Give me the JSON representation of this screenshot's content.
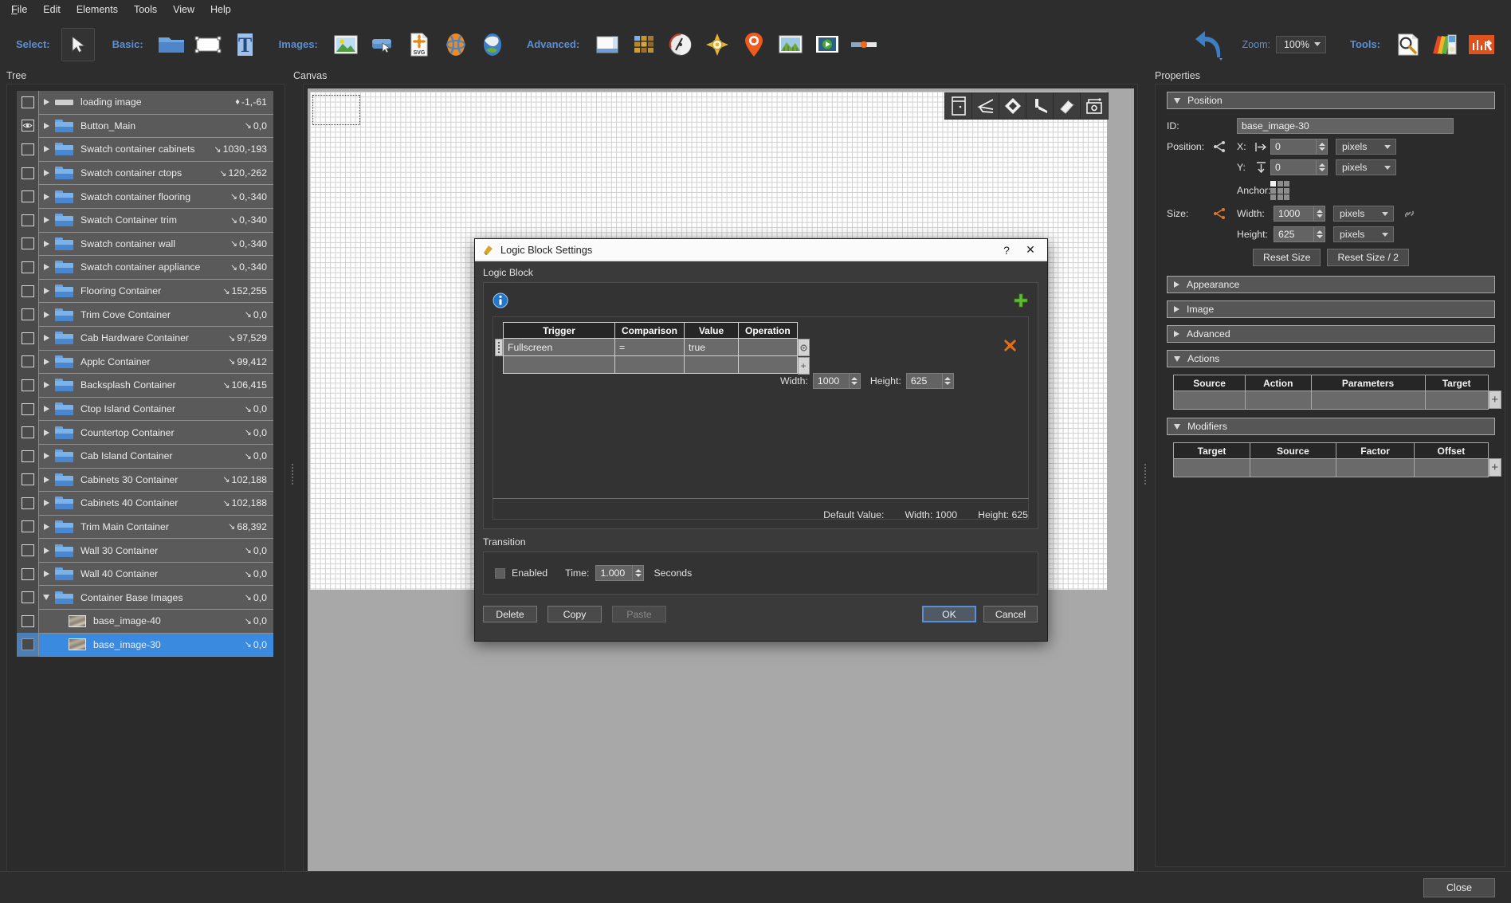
{
  "menubar": [
    {
      "label": "File",
      "accel": "F"
    },
    {
      "label": "Edit",
      "accel": "E"
    },
    {
      "label": "Elements",
      "accel": "l"
    },
    {
      "label": "Tools",
      "accel": "T"
    },
    {
      "label": "View",
      "accel": "V"
    },
    {
      "label": "Help",
      "accel": "H"
    }
  ],
  "toolbar": {
    "select_label": "Select:",
    "basic_label": "Basic:",
    "images_label": "Images:",
    "advanced_label": "Advanced:",
    "zoom_label": "Zoom:",
    "zoom_value": "100%",
    "tools_label": "Tools:",
    "select_tools": [
      {
        "name": "arrow-cursor-icon"
      }
    ],
    "basic_tools": [
      {
        "name": "folder-icon"
      },
      {
        "name": "rectangle-icon"
      },
      {
        "name": "text-icon"
      }
    ],
    "image_tools": [
      {
        "name": "picture-icon"
      },
      {
        "name": "button-image-icon"
      },
      {
        "name": "svg-file-icon"
      },
      {
        "name": "globe-image-icon"
      },
      {
        "name": "map-image-icon"
      }
    ],
    "advanced_tools": [
      {
        "name": "window-layout-icon"
      },
      {
        "name": "grid-tiles-icon"
      },
      {
        "name": "gauge-icon"
      },
      {
        "name": "compass-icon"
      },
      {
        "name": "map-pin-icon"
      },
      {
        "name": "panorama-icon"
      },
      {
        "name": "video-icon"
      },
      {
        "name": "slider-icon"
      }
    ],
    "undo": {
      "name": "undo-arrow-icon"
    },
    "right_tools": [
      {
        "name": "magnifier-page-icon"
      },
      {
        "name": "color-swatch-icon"
      },
      {
        "name": "toolbox-icon"
      }
    ]
  },
  "tree": {
    "title": "Tree",
    "items": [
      {
        "label": "loading image",
        "pos": "-1,-61",
        "glyph": "dot",
        "icon": "bar-image-icon",
        "visible": false,
        "expandable": true,
        "expanded": false,
        "child": false,
        "selected": false
      },
      {
        "label": "Button_Main",
        "pos": "0,0",
        "glyph": "arrow",
        "icon": "folder-icon",
        "visible": true,
        "expandable": true,
        "expanded": false,
        "child": false,
        "selected": false
      },
      {
        "label": "Swatch container cabinets",
        "pos": "1030,-193",
        "glyph": "arrow",
        "icon": "folder-icon",
        "visible": false,
        "expandable": true,
        "expanded": false,
        "child": false,
        "selected": false
      },
      {
        "label": "Swatch container ctops",
        "pos": "120,-262",
        "glyph": "arrow",
        "icon": "folder-icon",
        "visible": false,
        "expandable": true,
        "expanded": false,
        "child": false,
        "selected": false
      },
      {
        "label": "Swatch container flooring",
        "pos": "0,-340",
        "glyph": "arrow",
        "icon": "folder-icon",
        "visible": false,
        "expandable": true,
        "expanded": false,
        "child": false,
        "selected": false
      },
      {
        "label": "Swatch Container trim",
        "pos": "0,-340",
        "glyph": "arrow",
        "icon": "folder-icon",
        "visible": false,
        "expandable": true,
        "expanded": false,
        "child": false,
        "selected": false
      },
      {
        "label": "Swatch container wall",
        "pos": "0,-340",
        "glyph": "arrow",
        "icon": "folder-icon",
        "visible": false,
        "expandable": true,
        "expanded": false,
        "child": false,
        "selected": false
      },
      {
        "label": "Swatch container appliance",
        "pos": "0,-340",
        "glyph": "arrow",
        "icon": "folder-icon",
        "visible": false,
        "expandable": true,
        "expanded": false,
        "child": false,
        "selected": false
      },
      {
        "label": "Flooring Container",
        "pos": "152,255",
        "glyph": "arrow",
        "icon": "folder-icon",
        "visible": false,
        "expandable": true,
        "expanded": false,
        "child": false,
        "selected": false
      },
      {
        "label": "Trim Cove Container",
        "pos": "0,0",
        "glyph": "arrow",
        "icon": "folder-icon",
        "visible": false,
        "expandable": true,
        "expanded": false,
        "child": false,
        "selected": false
      },
      {
        "label": "Cab Hardware Container",
        "pos": "97,529",
        "glyph": "arrow",
        "icon": "folder-icon",
        "visible": false,
        "expandable": true,
        "expanded": false,
        "child": false,
        "selected": false
      },
      {
        "label": "Applc Container",
        "pos": "99,412",
        "glyph": "arrow",
        "icon": "folder-icon",
        "visible": false,
        "expandable": true,
        "expanded": false,
        "child": false,
        "selected": false
      },
      {
        "label": "Backsplash Container",
        "pos": "106,415",
        "glyph": "arrow",
        "icon": "folder-icon",
        "visible": false,
        "expandable": true,
        "expanded": false,
        "child": false,
        "selected": false
      },
      {
        "label": "Ctop Island Container",
        "pos": "0,0",
        "glyph": "arrow",
        "icon": "folder-icon",
        "visible": false,
        "expandable": true,
        "expanded": false,
        "child": false,
        "selected": false
      },
      {
        "label": "Countertop Container",
        "pos": "0,0",
        "glyph": "arrow",
        "icon": "folder-icon",
        "visible": false,
        "expandable": true,
        "expanded": false,
        "child": false,
        "selected": false
      },
      {
        "label": "Cab Island Container",
        "pos": "0,0",
        "glyph": "arrow",
        "icon": "folder-icon",
        "visible": false,
        "expandable": true,
        "expanded": false,
        "child": false,
        "selected": false
      },
      {
        "label": "Cabinets 30 Container",
        "pos": "102,188",
        "glyph": "arrow",
        "icon": "folder-icon",
        "visible": false,
        "expandable": true,
        "expanded": false,
        "child": false,
        "selected": false
      },
      {
        "label": "Cabinets 40 Container",
        "pos": "102,188",
        "glyph": "arrow",
        "icon": "folder-icon",
        "visible": false,
        "expandable": true,
        "expanded": false,
        "child": false,
        "selected": false
      },
      {
        "label": "Trim Main Container",
        "pos": "68,392",
        "glyph": "arrow",
        "icon": "folder-icon",
        "visible": false,
        "expandable": true,
        "expanded": false,
        "child": false,
        "selected": false
      },
      {
        "label": "Wall 30 Container",
        "pos": "0,0",
        "glyph": "arrow",
        "icon": "folder-icon",
        "visible": false,
        "expandable": true,
        "expanded": false,
        "child": false,
        "selected": false
      },
      {
        "label": "Wall 40 Container",
        "pos": "0,0",
        "glyph": "arrow",
        "icon": "folder-icon",
        "visible": false,
        "expandable": true,
        "expanded": false,
        "child": false,
        "selected": false
      },
      {
        "label": "Container Base Images",
        "pos": "0,0",
        "glyph": "arrow",
        "icon": "folder-icon",
        "visible": false,
        "expandable": true,
        "expanded": true,
        "child": false,
        "selected": false
      },
      {
        "label": "base_image-40",
        "pos": "0,0",
        "glyph": "arrow",
        "icon": "thumbnail-icon",
        "visible": false,
        "expandable": false,
        "expanded": false,
        "child": true,
        "selected": false
      },
      {
        "label": "base_image-30",
        "pos": "0,0",
        "glyph": "arrow",
        "icon": "thumbnail-icon",
        "visible": false,
        "expandable": false,
        "expanded": false,
        "child": true,
        "selected": true
      }
    ]
  },
  "canvas": {
    "title": "Canvas",
    "tools": [
      {
        "name": "cabinet-icon"
      },
      {
        "name": "ceiling-icon"
      },
      {
        "name": "floor-tile-icon"
      },
      {
        "name": "counter-icon"
      },
      {
        "name": "paint-roller-icon"
      },
      {
        "name": "appliance-icon"
      }
    ]
  },
  "properties": {
    "title": "Properties",
    "position_section": {
      "label": "Position",
      "expanded": true,
      "id_label": "ID:",
      "id_value": "base_image-30",
      "position_label": "Position:",
      "x_label": "X:",
      "x_value": "0",
      "x_units": "pixels",
      "y_label": "Y:",
      "y_value": "0",
      "y_units": "pixels",
      "anchor_label": "Anchor:",
      "size_label": "Size:",
      "width_label": "Width:",
      "width_value": "1000",
      "width_units": "pixels",
      "height_label": "Height:",
      "height_value": "625",
      "height_units": "pixels",
      "reset_size": "Reset Size",
      "reset_size_half": "Reset Size / 2"
    },
    "sections": [
      {
        "label": "Appearance",
        "expanded": false
      },
      {
        "label": "Image",
        "expanded": false
      },
      {
        "label": "Advanced",
        "expanded": false
      }
    ],
    "actions": {
      "label": "Actions",
      "expanded": true,
      "columns": [
        "Source",
        "Action",
        "Parameters",
        "Target"
      ],
      "rows": [
        [
          "",
          "",
          "",
          ""
        ]
      ]
    },
    "modifiers": {
      "label": "Modifiers",
      "expanded": true,
      "columns": [
        "Target",
        "Source",
        "Factor",
        "Offset"
      ],
      "rows": [
        [
          "",
          "",
          "",
          ""
        ]
      ]
    }
  },
  "dialog": {
    "title": "Logic Block Settings",
    "icon": "app-logo-icon",
    "help_label": "?",
    "close_label": "✕",
    "section_label": "Logic Block",
    "info_icon": "info-icon",
    "add_icon": "add-plus-icon",
    "delete_row_icon": "delete-x-icon",
    "table": {
      "columns": [
        "Trigger",
        "Comparison",
        "Value",
        "Operation"
      ],
      "rows": [
        {
          "trigger": "Fullscreen",
          "comparison": "=",
          "value": "true",
          "operation": ""
        },
        {
          "trigger": "",
          "comparison": "",
          "value": "",
          "operation": ""
        }
      ]
    },
    "width_label": "Width:",
    "width_value": "1000",
    "height_label": "Height:",
    "height_value": "625",
    "default_value_label": "Default Value:",
    "default_width_label": "Width:",
    "default_width_value": "1000",
    "default_height_label": "Height:",
    "default_height_value": "625",
    "transition": {
      "label": "Transition",
      "enabled_label": "Enabled",
      "enabled_checked": false,
      "time_label": "Time:",
      "time_value": "1.000",
      "seconds_label": "Seconds"
    },
    "buttons": {
      "delete": "Delete",
      "copy": "Copy",
      "paste": "Paste",
      "ok": "OK",
      "cancel": "Cancel"
    }
  },
  "footer": {
    "close_label": "Close"
  },
  "colors": {
    "accent_blue": "#5b8fd4",
    "selection_blue": "#3a8ae0",
    "panel_bg": "#2d2d2d",
    "row_bg": "#5a5a5a",
    "orange": "#e07020",
    "green": "#5fbb2f"
  }
}
